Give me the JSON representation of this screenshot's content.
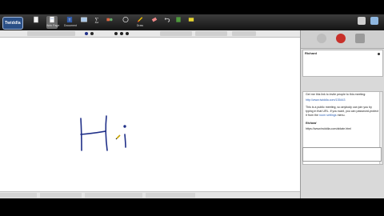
{
  "app": {
    "logo_text": "Twiddla",
    "colors": {
      "toolbar": "#1c1c1c",
      "canvas": "#ffffff",
      "ink": "#1f2f88",
      "panel": "#d9d9d9"
    }
  },
  "toolbar": {
    "tools": [
      {
        "label": "",
        "icon": "page-icon"
      },
      {
        "label": "Web Page",
        "icon": "web-page-icon"
      },
      {
        "label": "Document",
        "icon": "document-icon"
      },
      {
        "label": "",
        "icon": "image-icon"
      },
      {
        "label": "",
        "icon": "math-icon"
      },
      {
        "label": "",
        "icon": "shapes-icon"
      },
      {
        "label": "",
        "icon": "audio-icon"
      },
      {
        "label": "Draw",
        "icon": "pen-icon"
      },
      {
        "label": "",
        "icon": "eraser-icon"
      },
      {
        "label": "",
        "icon": "undo-icon"
      },
      {
        "label": "",
        "icon": "save-icon"
      },
      {
        "label": "",
        "icon": "settings-icon"
      }
    ]
  },
  "canvas": {
    "handwriting": "Hi"
  },
  "panel": {
    "user": "Richard",
    "chat_intro": "Get me this link to invite people to this meeting:",
    "chat_link": "http://www.twiddla.com/135443",
    "chat_public": "This is a public meeting, so anybody can join you by typing in that URL. If you want, you can password-protect it from the",
    "chat_link2": "room settings",
    "chat_public_end": "menu.",
    "chat_name": "Richard",
    "chat_message": "https://www.twiddla.com/ablate.html"
  }
}
